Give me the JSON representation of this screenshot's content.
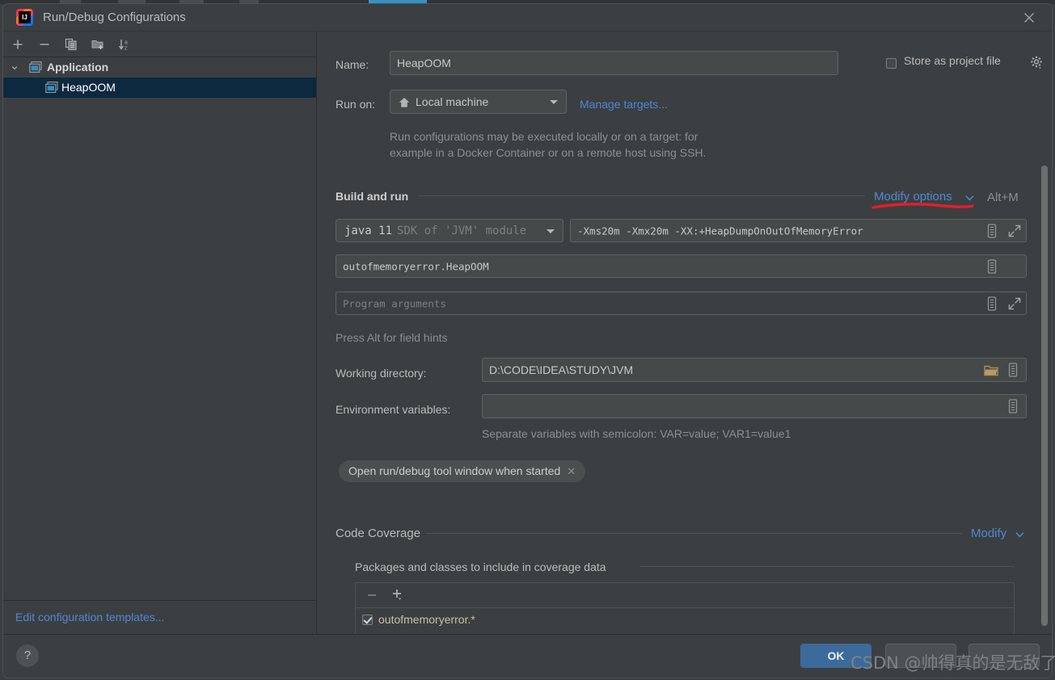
{
  "window": {
    "title": "Run/Debug Configurations",
    "app_icon": "intellij-idea-icon",
    "close_icon": "close-icon"
  },
  "sidebar": {
    "toolbar": [
      {
        "name": "add-configuration-button",
        "icon": "plus-icon"
      },
      {
        "name": "remove-configuration-button",
        "icon": "minus-icon"
      },
      {
        "name": "copy-configuration-button",
        "icon": "copy-icon"
      },
      {
        "name": "new-folder-button",
        "icon": "folder-add-icon"
      },
      {
        "name": "sort-configurations-button",
        "icon": "sort-az-icon"
      }
    ],
    "tree": [
      {
        "label": "Application",
        "type": "group",
        "expanded": true,
        "selected": false
      },
      {
        "label": "HeapOOM",
        "type": "item",
        "expanded": false,
        "selected": true
      }
    ],
    "edit_templates_link": "Edit configuration templates..."
  },
  "form": {
    "name_label": "Name:",
    "name_value": "HeapOOM",
    "store_as_project_file_label": "Store as project file",
    "store_as_project_file_checked": false,
    "store_gear_icon": "gear-icon",
    "run_on_label": "Run on:",
    "run_on_value": "Local machine",
    "run_on_icon": "home-icon",
    "manage_targets_link": "Manage targets...",
    "run_on_hint_line1": "Run configurations may be executed locally or on a target: for",
    "run_on_hint_line2": "example in a Docker Container or on a remote host using SSH."
  },
  "build_and_run": {
    "section_title": "Build and run",
    "modify_options_link": "Modify options",
    "modify_options_chevron": "chevron-down-icon",
    "modify_options_shortcut": "Alt+M",
    "jre_value": "java 11",
    "jre_suffix": "SDK of 'JVM' module",
    "vm_options_value": "-Xms20m -Xmx20m -XX:+HeapDumpOnOutOfMemoryError",
    "vm_options_macro_icon": "macro-list-icon",
    "vm_options_expand_icon": "expand-icon",
    "main_class_value": "outofmemoryerror.HeapOOM",
    "main_class_macro_icon": "macro-list-icon",
    "program_arguments_placeholder": "Program arguments",
    "program_arguments_value": "",
    "program_args_macro_icon": "macro-list-icon",
    "program_args_expand_icon": "expand-icon",
    "field_hints_note": "Press Alt for field hints",
    "working_directory_label": "Working directory:",
    "working_directory_value": "D:\\CODE\\IDEA\\STUDY\\JVM",
    "working_dir_browse_icon": "folder-icon",
    "working_dir_macro_icon": "macro-list-icon",
    "environment_variables_label": "Environment variables:",
    "environment_variables_value": "",
    "environment_macro_icon": "macro-list-icon",
    "environment_hint": "Separate variables with semicolon: VAR=value; VAR1=value1",
    "option_chip_label": "Open run/debug tool window when started",
    "option_chip_remove_icon": "close-icon"
  },
  "code_coverage": {
    "section_title": "Code Coverage",
    "modify_link": "Modify",
    "modify_chevron": "chevron-down-icon",
    "packages_section_title": "Packages and classes to include in coverage data",
    "toolbar": [
      {
        "name": "remove-package-button",
        "icon": "minus-icon"
      },
      {
        "name": "add-package-button",
        "icon": "plus-dropdown-icon"
      }
    ],
    "rows": [
      {
        "label": "outofmemoryerror.*",
        "checked": true
      }
    ]
  },
  "footer": {
    "help_label": "?",
    "ok_label": "OK",
    "cancel_label": "",
    "apply_label": ""
  },
  "annotation": {
    "underline_color": "#e31f26",
    "target": "Modify options"
  },
  "watermark": {
    "text": "CSDN @帅得真的是无敌了"
  },
  "colors": {
    "dialog_bg": "#3c3f41",
    "field_bg": "#45494a",
    "selection_bg": "#0d293f",
    "link_blue": "#4d88d4",
    "primary_button": "#3c6a9a",
    "text": "#bbbbbb"
  }
}
